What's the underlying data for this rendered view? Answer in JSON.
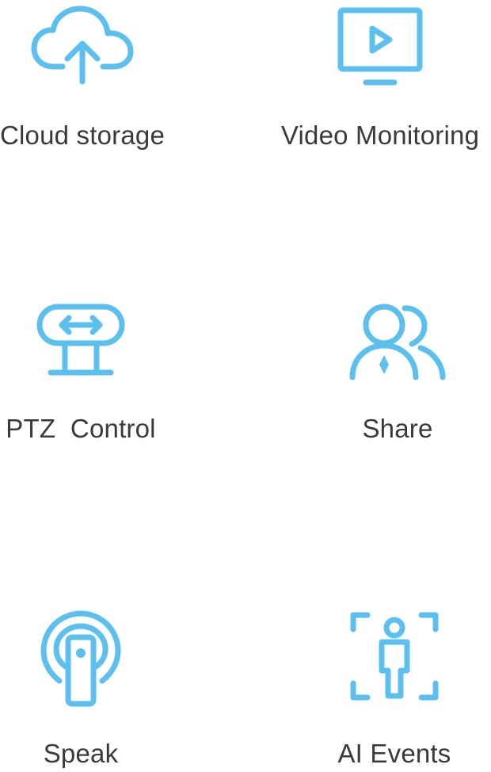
{
  "accent_color": "#5bc0ee",
  "text_color": "#3a3a3a",
  "features": [
    {
      "label": "Cloud storage",
      "icon": "cloud-upload-icon"
    },
    {
      "label": "Video Monitoring",
      "icon": "monitor-play-icon"
    },
    {
      "label": "PTZ  Control",
      "icon": "ptz-camera-icon"
    },
    {
      "label": "Share",
      "icon": "users-share-icon"
    },
    {
      "label": "Speak",
      "icon": "microphone-speak-icon"
    },
    {
      "label": "AI Events",
      "icon": "ai-person-detect-icon"
    }
  ]
}
